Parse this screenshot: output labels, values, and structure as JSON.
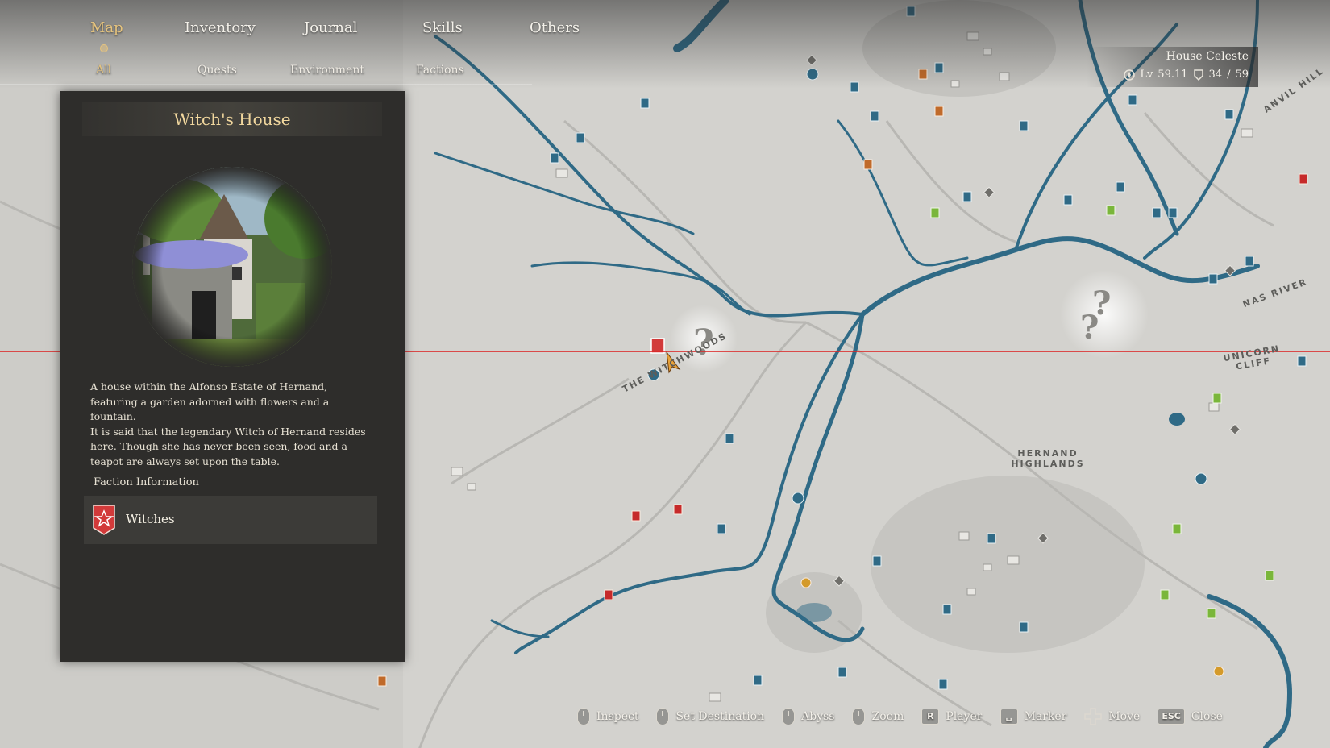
{
  "nav": {
    "main_tabs": [
      {
        "label": "Map",
        "active": true
      },
      {
        "label": "Inventory",
        "active": false
      },
      {
        "label": "Journal",
        "active": false
      },
      {
        "label": "Skills",
        "active": false
      },
      {
        "label": "Others",
        "active": false
      }
    ],
    "sub_tabs": [
      {
        "label": "All",
        "active": true
      },
      {
        "label": "Quests",
        "active": false
      },
      {
        "label": "Environment",
        "active": false
      },
      {
        "label": "Factions",
        "active": false
      }
    ]
  },
  "panel": {
    "title": "Witch's House",
    "description_1": "A house within the Alfonso Estate of Hernand, featuring a garden adorned with flowers and a fountain.",
    "description_2": "It is said that the legendary Witch of Hernand resides here. Though she has never been seen, food and a teapot are always set upon the table.",
    "faction_heading": "Faction Information",
    "faction_name": "Witches"
  },
  "house": {
    "name": "House Celeste",
    "level_label": "Lv",
    "level": "59.11",
    "count": "34",
    "count_max": "59"
  },
  "map_labels": {
    "witchwoods": "THE WITCHWOODS",
    "highlands": "HERNAND HIGHLANDS",
    "nas_river": "NAS RIVER",
    "unicorn_cliff": "UNICORN CLIFF",
    "anvil_hill": "ANVIL HILL"
  },
  "controls": [
    {
      "icon": "mouse-left-icon",
      "label": "Inspect"
    },
    {
      "icon": "mouse-right-icon",
      "label": "Set Destination"
    },
    {
      "icon": "mouse-right-icon",
      "label": "Abyss"
    },
    {
      "icon": "mouse-wheel-icon",
      "label": "Zoom"
    },
    {
      "key": "R",
      "label": "Player"
    },
    {
      "key": "␣",
      "label": "Marker"
    },
    {
      "icon": "dpad-icon",
      "label": "Move"
    },
    {
      "key": "ESC",
      "label": "Close"
    }
  ],
  "colors": {
    "gold_accent": "#e6c47f",
    "title_gold": "#f1d79e",
    "panel_bg": "#2e2d2b",
    "river_blue": "#2f6a86",
    "map_bg": "#cfcecb",
    "crosshair": "#dc2828",
    "faction_red": "#d23a3a"
  }
}
